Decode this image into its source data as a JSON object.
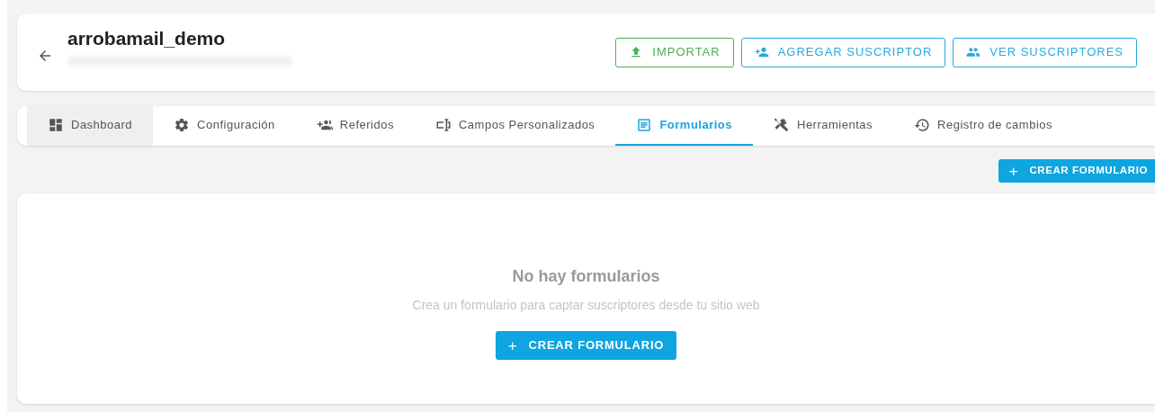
{
  "header": {
    "title": "arrobamail_demo",
    "actions": [
      {
        "label": "IMPORTAR",
        "kind": "import",
        "color": "#4caf50"
      },
      {
        "label": "AGREGAR SUSCRIPTOR",
        "kind": "add-person",
        "color": "#29a9e1"
      },
      {
        "label": "VER SUSCRIPTORES",
        "kind": "people",
        "color": "#29a9e1"
      }
    ]
  },
  "tabs": [
    {
      "label": "Dashboard",
      "kind": "dashboard",
      "selected": false,
      "hovered": true
    },
    {
      "label": "Configuración",
      "kind": "gear",
      "selected": false,
      "hovered": false
    },
    {
      "label": "Referidos",
      "kind": "add-people",
      "selected": false,
      "hovered": false
    },
    {
      "label": "Campos Personalizados",
      "kind": "field",
      "selected": false,
      "hovered": false
    },
    {
      "label": "Formularios",
      "kind": "form",
      "selected": true,
      "hovered": false
    },
    {
      "label": "Herramientas",
      "kind": "tools",
      "selected": false,
      "hovered": false
    },
    {
      "label": "Registro de cambios",
      "kind": "history",
      "selected": false,
      "hovered": false
    }
  ],
  "toolbar_button": {
    "icon": "+",
    "label": "CREAR FORMULARIO"
  },
  "empty_state": {
    "title": "No hay formularios",
    "message": "Crea un formulario para captar suscriptores desde tu sitio web",
    "button": {
      "icon": "+",
      "label": "CREAR FORMULARIO"
    }
  }
}
